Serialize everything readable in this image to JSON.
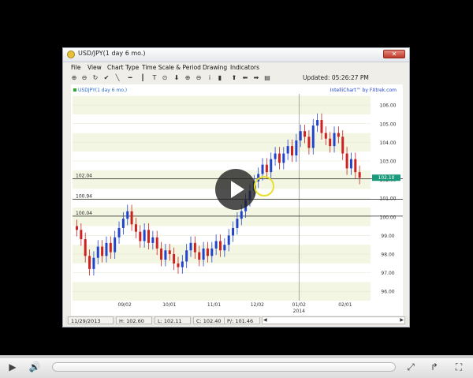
{
  "window": {
    "title": "USD/JPY(1 day  6 mo.)",
    "close_label": "✕"
  },
  "menu": [
    "File",
    "View",
    "Chart Type",
    "Time Scale & Period",
    "Drawing",
    "Indicators"
  ],
  "toolbar": {
    "icons": [
      "zoom-in-icon",
      "zoom-out-icon",
      "refresh-icon",
      "check-icon",
      "line-draw-icon",
      "horizontal-line-icon",
      "vertical-line-icon",
      "text-icon",
      "crosshair-icon",
      "down-arrow-icon",
      "magnify-plus-icon",
      "magnify-minus-icon",
      "info-icon",
      "bars-icon",
      "up-arrow-icon",
      "left-arrow-icon",
      "right-arrow-icon",
      "chart-icon"
    ],
    "glyphs": [
      "⊕",
      "⊖",
      "↻",
      "✔",
      "╲",
      "━",
      "┃",
      "T",
      "⊙",
      "⬇",
      "⊕",
      "⊖",
      "i",
      "▮",
      "⬆",
      "⬅",
      "➡",
      "▤"
    ],
    "updated_label": "Updated: 05:26:27 PM"
  },
  "chart_data": {
    "type": "candlestick",
    "legend_label": "USDJPY(1 day  6 mo.)",
    "brand": "IntelliChart™ by FXtrek.com",
    "y_ticks": [
      "106.00",
      "105.00",
      "104.00",
      "103.00",
      "102.00",
      "101.00",
      "100.00",
      "99.00",
      "98.00",
      "97.00",
      "96.00"
    ],
    "y_tick_values": [
      106,
      105,
      104,
      103,
      102,
      101,
      100,
      99,
      98,
      97,
      96
    ],
    "ylim": [
      95.5,
      106.6
    ],
    "x_ticks": [
      "09/02",
      "10/01",
      "11/01",
      "12/02",
      "01/02",
      "02/01"
    ],
    "x_tick_positions": [
      0.175,
      0.325,
      0.475,
      0.62,
      0.76,
      0.915
    ],
    "year_label": "2014",
    "year_position": 0.76,
    "current_price": "102.10",
    "current_value": 102.1,
    "hlines": [
      {
        "label": "102.04",
        "value": 102.04
      },
      {
        "label": "100.94",
        "value": 100.94
      },
      {
        "label": "100.04",
        "value": 100.04
      }
    ],
    "closes": [
      99.3,
      98.8,
      97.9,
      97.2,
      97.8,
      98.4,
      97.9,
      98.6,
      98.1,
      98.9,
      99.4,
      99.9,
      100.3,
      99.6,
      99.2,
      98.7,
      99.3,
      98.6,
      98.9,
      98.3,
      97.7,
      98.2,
      98.0,
      97.5,
      97.3,
      97.6,
      98.2,
      98.6,
      98.1,
      97.7,
      98.3,
      97.9,
      98.3,
      98.7,
      98.2,
      98.5,
      99.0,
      99.4,
      99.9,
      100.3,
      100.9,
      101.4,
      101.9,
      102.3,
      102.8,
      102.4,
      103.1,
      103.4,
      102.9,
      103.4,
      103.8,
      103.3,
      104.1,
      104.6,
      104.3,
      103.7,
      104.9,
      105.2,
      104.5,
      104.2,
      103.8,
      104.5,
      104.3,
      103.4,
      102.6,
      103.1,
      102.4,
      102.1
    ],
    "colors": {
      "up": "#2244cc",
      "down": "#cc2222",
      "band": "#f3f6e2",
      "grid": "#dfe6c8"
    }
  },
  "status": {
    "date": "11/29/2013",
    "high": "H: 102.60",
    "low": "L: 102.11",
    "close": "C: 102.40",
    "pivot": "P/: 101.46",
    "scroll_left": "◀",
    "scroll_right": "▶"
  },
  "player": {
    "play": "▶",
    "volume": "🔊",
    "fullscreen": "⤢",
    "share": "↱",
    "expand": "⛶"
  }
}
